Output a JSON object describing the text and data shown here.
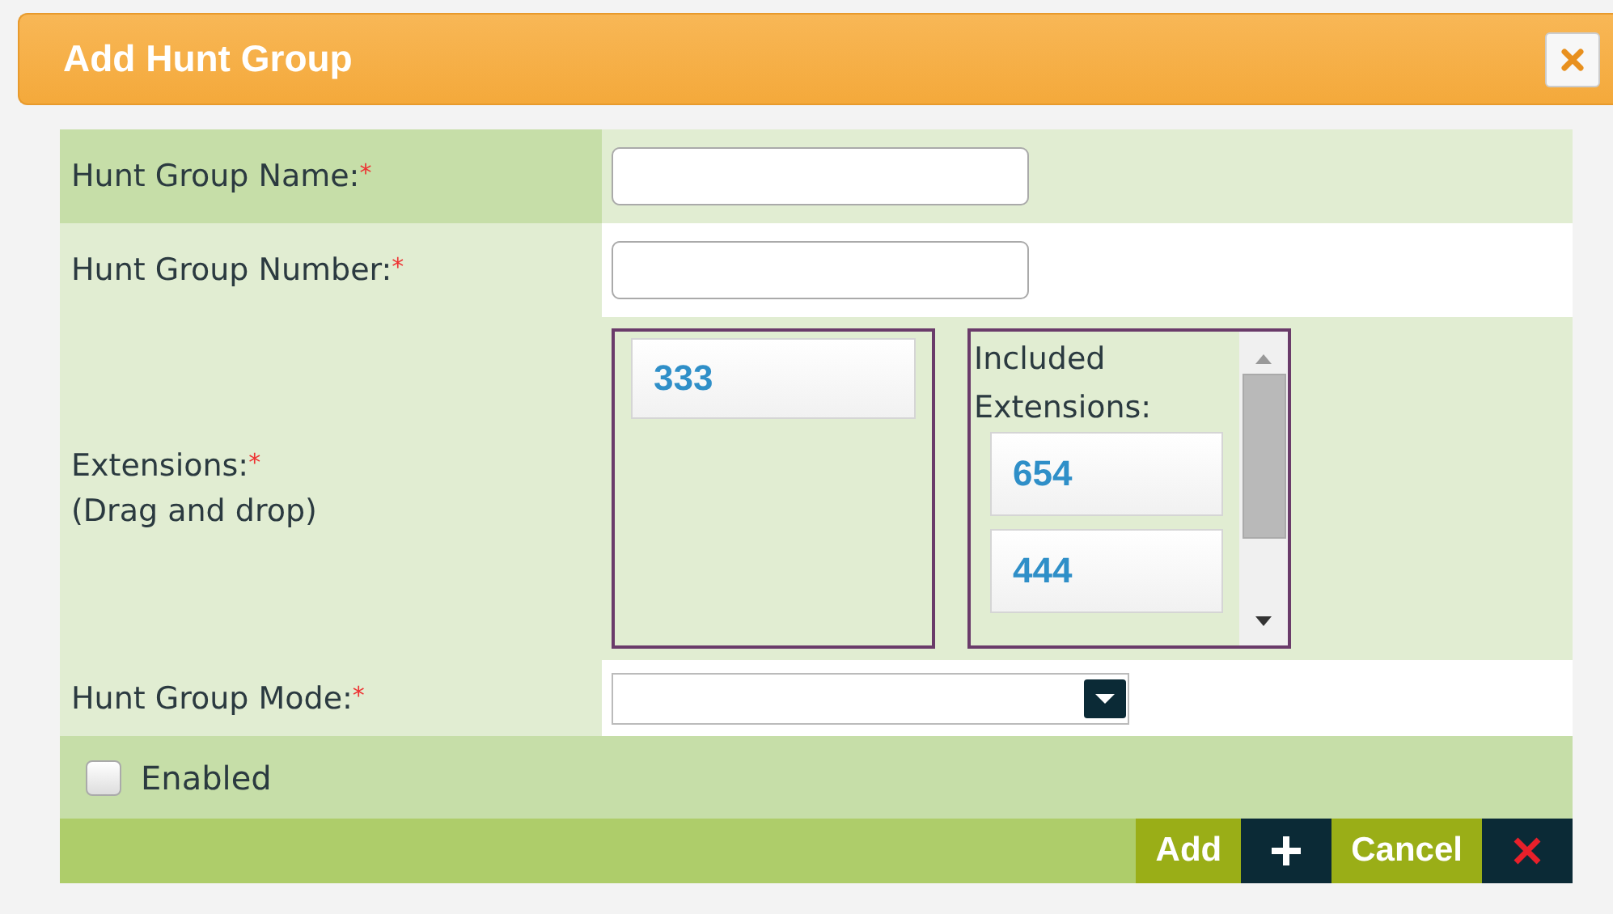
{
  "dialog": {
    "title": "Add Hunt Group"
  },
  "rows": [
    {
      "kind": "text",
      "label": "Hunt Group Name:",
      "required": "*"
    },
    {
      "kind": "text",
      "label": "Hunt Group Number:",
      "required": "*"
    },
    {
      "kind": "extensions",
      "label": "Extensions:",
      "required": "*",
      "note": "(Drag and drop)",
      "available": [
        "333"
      ],
      "included_title": "Included Extensions:",
      "included": [
        "654",
        "444"
      ]
    },
    {
      "kind": "select",
      "label": "Hunt Group Mode:",
      "required": "*"
    }
  ],
  "enabled": {
    "label": "Enabled",
    "checked": false
  },
  "buttons": [
    {
      "label": "Add",
      "kind": "add"
    },
    {
      "label": "Cancel",
      "kind": "cancel"
    }
  ]
}
